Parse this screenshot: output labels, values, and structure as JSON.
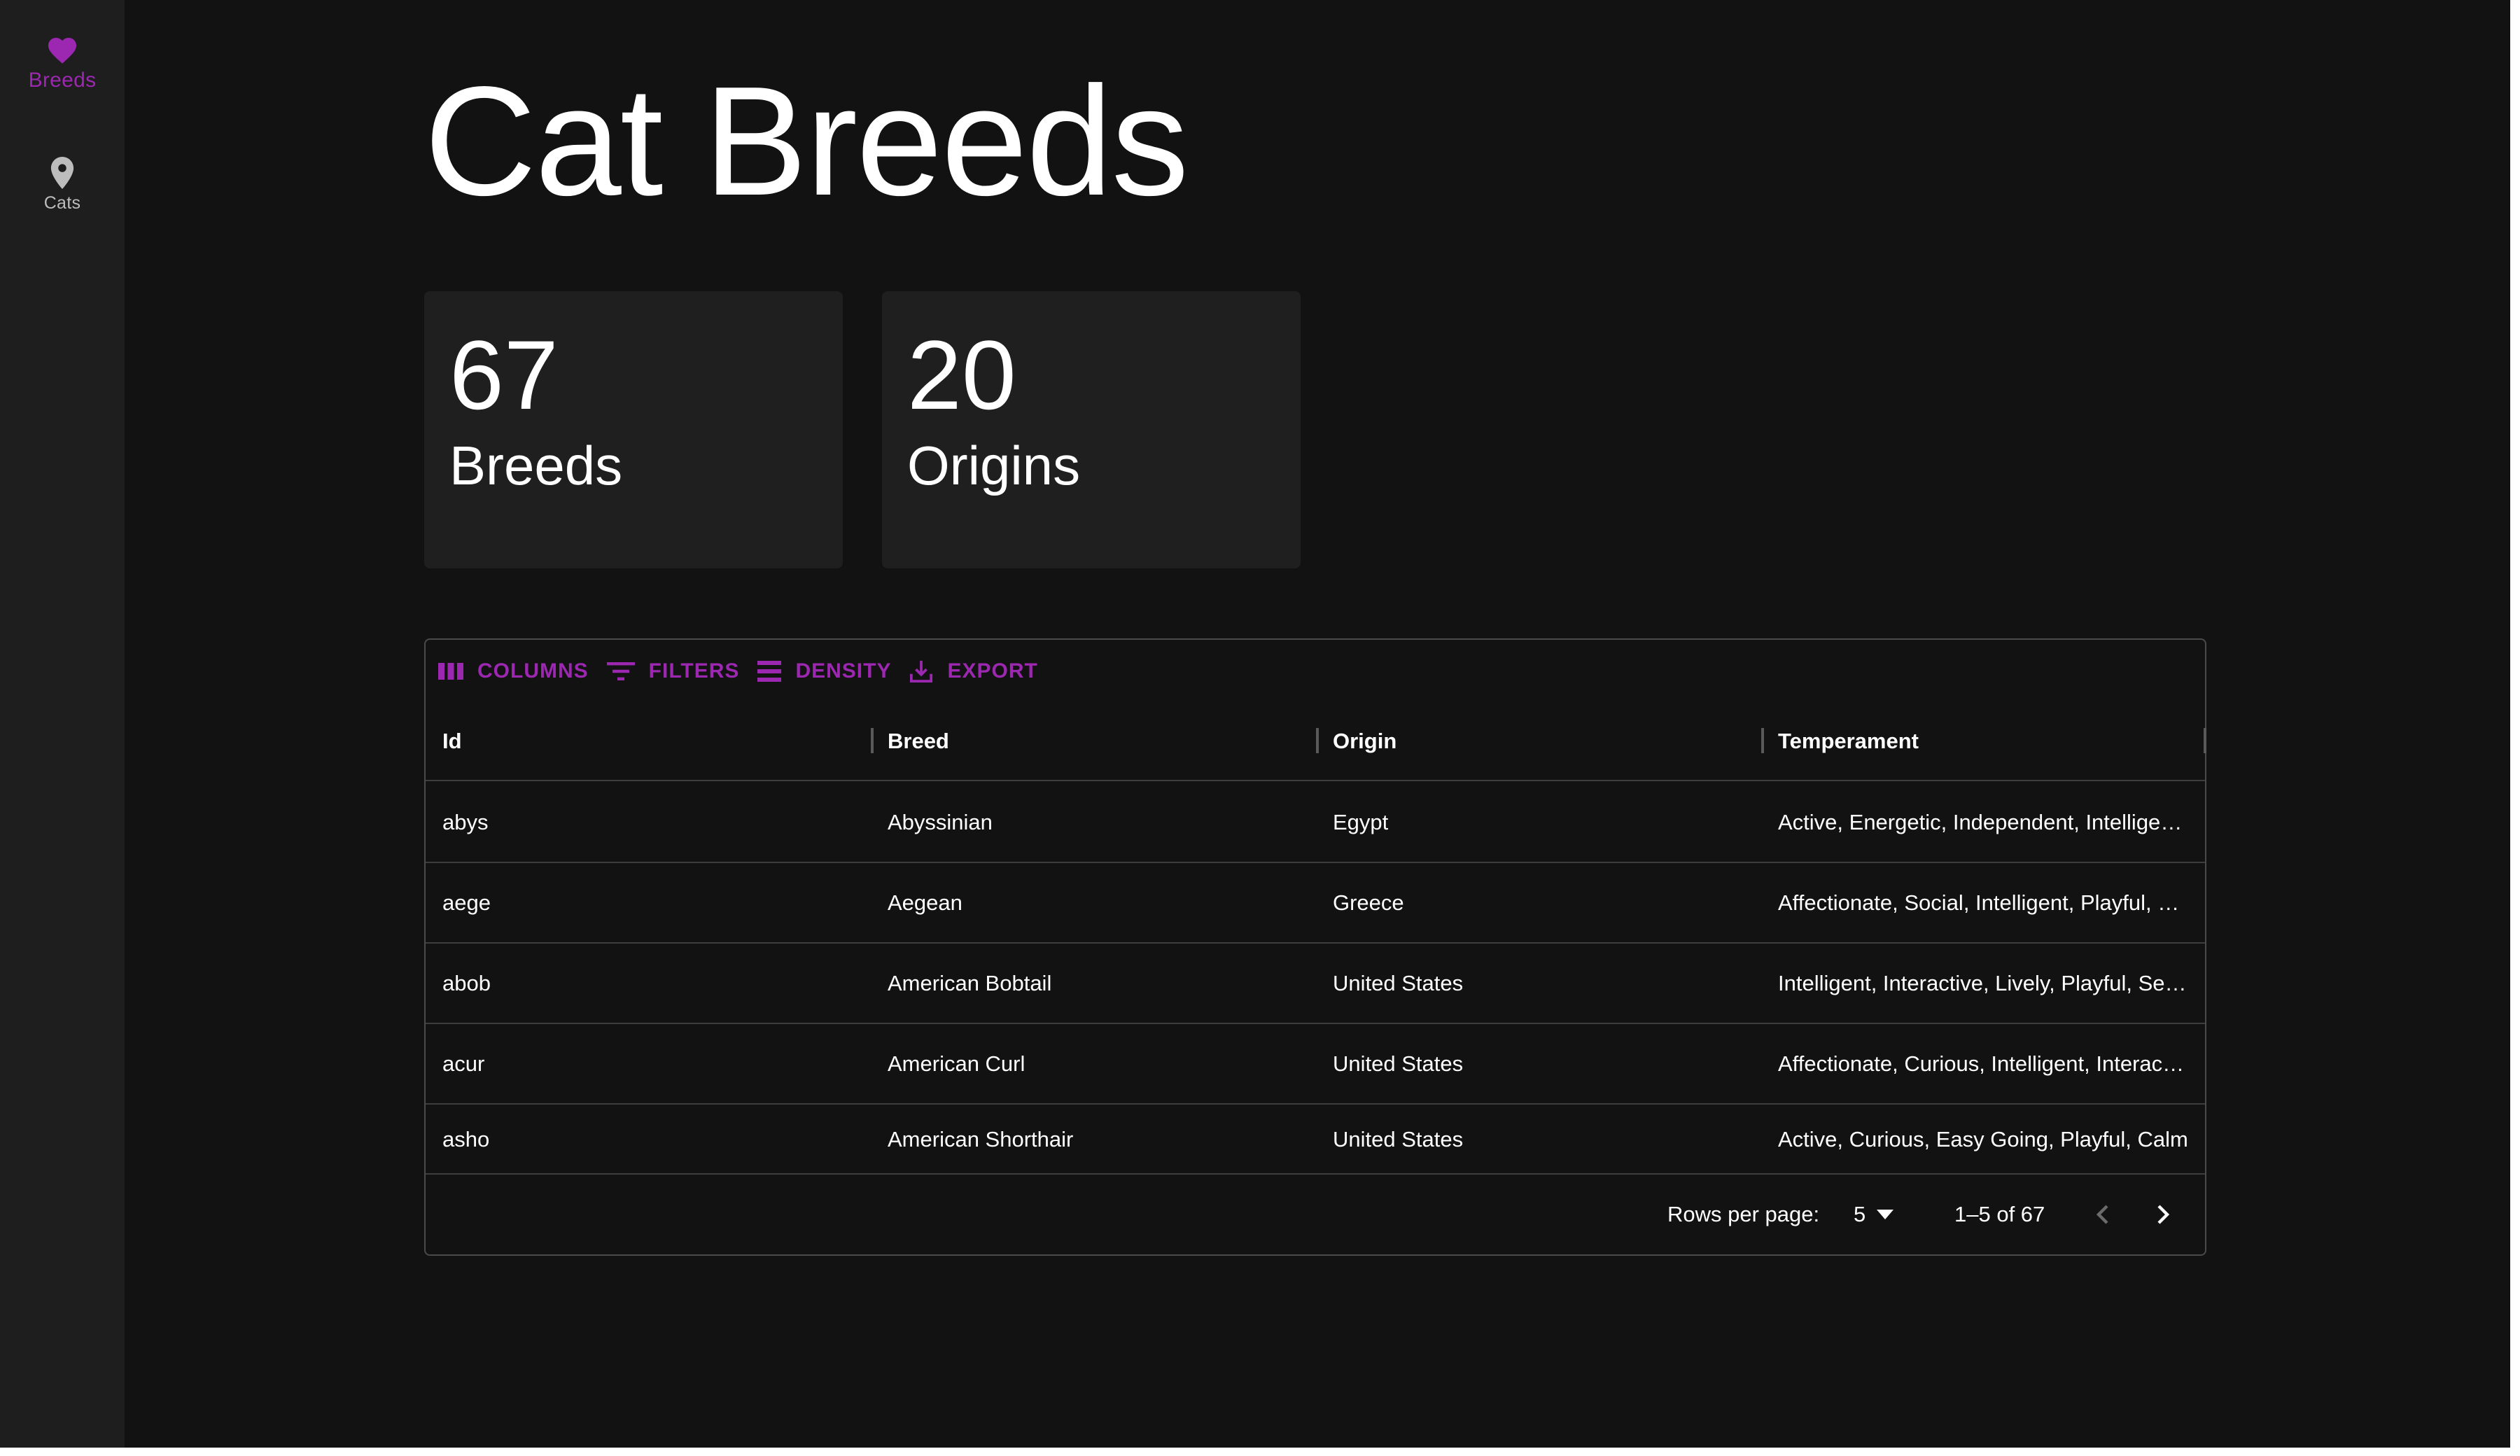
{
  "sidebar": {
    "items": [
      {
        "label": "Breeds",
        "icon": "heart-icon",
        "active": true
      },
      {
        "label": "Cats",
        "icon": "location-pin-icon",
        "active": false
      }
    ]
  },
  "page": {
    "title": "Cat Breeds"
  },
  "stats": [
    {
      "value": "67",
      "label": "Breeds"
    },
    {
      "value": "20",
      "label": "Origins"
    }
  ],
  "toolbar": {
    "columns_label": "COLUMNS",
    "filters_label": "FILTERS",
    "density_label": "DENSITY",
    "export_label": "EXPORT"
  },
  "table": {
    "columns": [
      "Id",
      "Breed",
      "Origin",
      "Temperament"
    ],
    "rows": [
      [
        "abys",
        "Abyssinian",
        "Egypt",
        "Active, Energetic, Independent, Intelligen…"
      ],
      [
        "aege",
        "Aegean",
        "Greece",
        "Affectionate, Social, Intelligent, Playful, …"
      ],
      [
        "abob",
        "American Bobtail",
        "United States",
        "Intelligent, Interactive, Lively, Playful, Se…"
      ],
      [
        "acur",
        "American Curl",
        "United States",
        "Affectionate, Curious, Intelligent, Interac…"
      ],
      [
        "asho",
        "American Shorthair",
        "United States",
        "Active, Curious, Easy Going, Playful, Calm"
      ]
    ]
  },
  "pagination": {
    "rows_per_page_label": "Rows per page:",
    "rows_per_page_value": "5",
    "range_text": "1–5 of 67"
  },
  "colors": {
    "accent": "#9c27b0",
    "background": "#121212",
    "sidebar": "#1e1e1e",
    "card": "#1f1f1f"
  }
}
